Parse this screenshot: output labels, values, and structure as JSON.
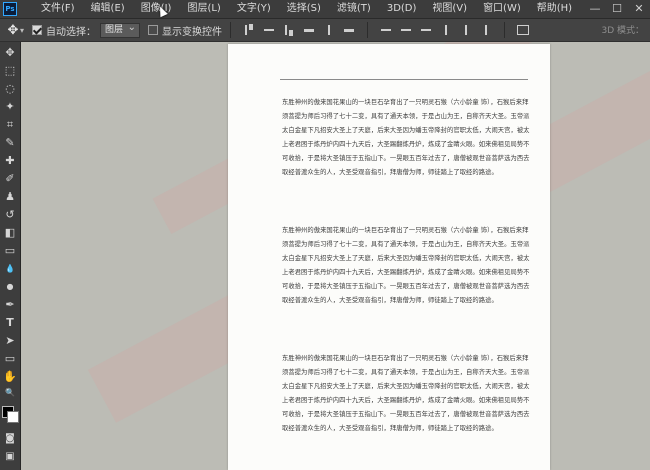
{
  "app": {
    "logo": "Ps"
  },
  "menubar": {
    "items": [
      "文件(F)",
      "编辑(E)",
      "图像(I)",
      "图层(L)",
      "文字(Y)",
      "选择(S)",
      "滤镜(T)",
      "3D(D)",
      "视图(V)",
      "窗口(W)",
      "帮助(H)"
    ],
    "window_buttons": [
      "—",
      "☐",
      "✕"
    ]
  },
  "options": {
    "auto_select_label": "自动选择：",
    "auto_select_value": "图层",
    "auto_select_checked": true,
    "show_transform_label": "显示变换控件",
    "show_transform_checked": false,
    "mode_3d_label": "3D 模式："
  },
  "tools": [
    "move-icon",
    "marquee-icon",
    "lasso-icon",
    "magic-wand-icon",
    "crop-icon",
    "eyedropper-icon",
    "healing-brush-icon",
    "brush-icon",
    "stamp-icon",
    "history-brush-icon",
    "eraser-icon",
    "gradient-icon",
    "blur-icon",
    "dodge-icon",
    "pen-icon",
    "type-icon",
    "path-selection-icon",
    "rectangle-icon",
    "hand-icon",
    "zoom-icon",
    "more-tools-icon"
  ],
  "tool_glyphs": [
    "✥",
    "⬚",
    "◌",
    "✦",
    "⌗",
    "✎",
    "✚",
    "✐",
    "♟",
    "↺",
    "◧",
    "▭",
    "💧",
    "●",
    "✒",
    "T",
    "➤",
    "▭",
    "✋",
    "🔍",
    "…"
  ],
  "colors": {
    "foreground": "#000000",
    "background": "#ffffff",
    "canvas_bg": "#bcbcb5",
    "watermark": "#d25050"
  },
  "document": {
    "paragraphs": [
      "东胜神州的傲来国花果山的一块巨石孕育出了一只明灵石猴（六小龄童 饰），石猴后来拜须菩提为师后习得了七十二变，具有了通天本领，于是占山为王，自称齐天大圣。玉帝派太白金星下凡招安大圣上了天庭，后来大圣因为蟠玉帝降封的官职太低，大闹天宫，被太上老君困于炼丹炉内四十九天后，大圣踢翻炼丹炉，炼成了金睛火眼。如来佛祖见局势不可收拾，于是将大圣镇压于五指山下。一晃眼五百年过去了，唐僧被观世音菩萨选为西去取经普渡众生的人，大圣受观音指引，拜唐僧为师，师徒踏上了取经的路途。",
      "东胜神州的傲来国花果山的一块巨石孕育出了一只明灵石猴（六小龄童 饰），石猴后来拜须菩提为师后习得了七十二变，具有了通天本领，于是占山为王，自称齐天大圣。玉帝派太白金星下凡招安大圣上了天庭，后来大圣因为蟠玉帝降封的官职太低，大闹天宫，被太上老君困于炼丹炉内四十九天后，大圣踢翻炼丹炉，炼成了金睛火眼。如来佛祖见局势不可收拾，于是将大圣镇压于五指山下。一晃眼五百年过去了，唐僧被观世音菩萨选为西去取经普渡众生的人，大圣受观音指引，拜唐僧为师，师徒踏上了取经的路途。",
      "东胜神州的傲来国花果山的一块巨石孕育出了一只明灵石猴（六小龄童 饰），石猴后来拜须菩提为师后习得了七十二变，具有了通天本领，于是占山为王，自称齐天大圣。玉帝派太白金星下凡招安大圣上了天庭，后来大圣因为蟠玉帝降封的官职太低，大闹天宫，被太上老君困于炼丹炉内四十九天后，大圣踢翻炼丹炉，炼成了金睛火眼。如来佛祖见局势不可收拾，于是将大圣镇压于五指山下。一晃眼五百年过去了，唐僧被观世音菩萨选为西去取经普渡众生的人，大圣受观音指引，拜唐僧为师，师徒踏上了取经的路途。"
    ]
  }
}
